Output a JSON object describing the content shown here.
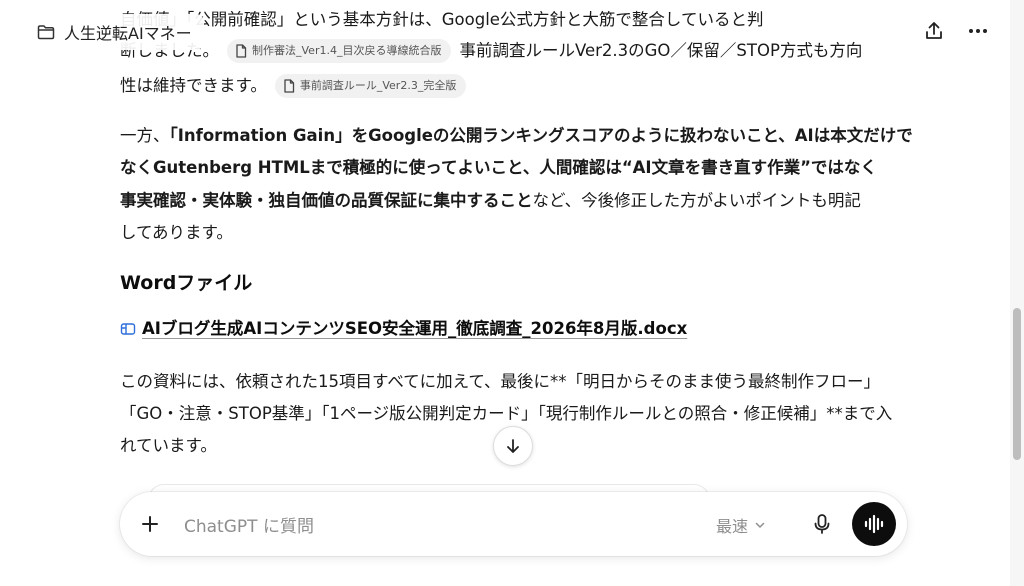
{
  "header": {
    "project_name": "人生逆転AIマネー"
  },
  "message": {
    "p1": {
      "l1_text": "自価値」「公開前確認」という基本方針は、Google公式方針と大筋で整合していると判",
      "l2_text_a": "断しました。",
      "l2_cite": "制作審法_Ver1.4_目次戻る導線統合版",
      "l2_text_b": "事前調査ルールVer2.3のGO／保留／STOP方式も方向",
      "l3_text": "性は維持できます。",
      "l3_cite": "事前調査ルール_Ver2.3_完全版"
    },
    "p2": {
      "l1_a": "一方、",
      "l1_b": "「Information Gain」をGoogleの公開ランキングスコアのように扱わないこと、AIは本文だけで",
      "l2": "なくGutenberg HTMLまで積極的に使ってよいこと、人間確認は“AI文章を書き直す作業”ではなく",
      "l3_bold": "事実確認・実体験・独自価値の品質保証に集中すること",
      "l3_tail": "など、今後修正した方がよいポイントも明記",
      "l4": "してあります。"
    },
    "heading": "Wordファイル",
    "file_link": "AIブログ生成AIコンテンツSEO安全運用_徹底調査_2026年8月版.docx",
    "p3": {
      "l1": "この資料には、依頼された15項目すべてに加えて、最後に**「明日からそのまま使う最終制作フロー」",
      "l2": "「GO・注意・STOP基準」「1ページ版公開判定カード」「現行制作ルールとの照合・修正候補」**まで入",
      "l3": "れています。"
    }
  },
  "composer": {
    "placeholder": "ChatGPT に質問",
    "model_label": "最速"
  },
  "icons": [
    "folder-icon",
    "share-icon",
    "more-icon",
    "document-icon",
    "file-icon",
    "arrow-down-icon",
    "plus-icon",
    "chevron-down-icon",
    "mic-icon",
    "voice-mode-icon"
  ]
}
